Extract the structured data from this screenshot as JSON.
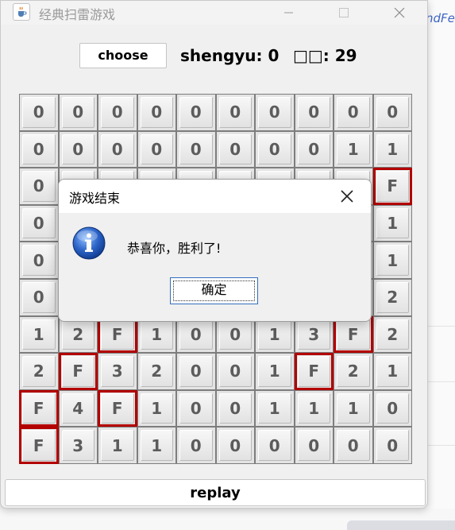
{
  "window": {
    "title": "经典扫雷游戏",
    "icon": "java-cup-icon"
  },
  "toolbar": {
    "choose_label": "choose",
    "shengyu_text": "shengyu: 0",
    "mines_text": "□□: 29"
  },
  "board": {
    "rows": [
      [
        "0",
        "0",
        "0",
        "0",
        "0",
        "0",
        "0",
        "0",
        "0",
        "0"
      ],
      [
        "0",
        "0",
        "0",
        "0",
        "0",
        "0",
        "0",
        "0",
        "1",
        "1"
      ],
      [
        "0",
        "",
        "",
        "",
        "",
        "",
        "",
        "",
        "",
        "F"
      ],
      [
        "0",
        "",
        "",
        "",
        "",
        "",
        "",
        "",
        "",
        "1"
      ],
      [
        "0",
        "",
        "",
        "",
        "",
        "",
        "",
        "",
        "",
        "1"
      ],
      [
        "0",
        "",
        "",
        "",
        "",
        "",
        "",
        "",
        "",
        "2"
      ],
      [
        "1",
        "2",
        "F",
        "1",
        "0",
        "0",
        "1",
        "3",
        "F",
        "2"
      ],
      [
        "2",
        "F",
        "3",
        "2",
        "0",
        "0",
        "1",
        "F",
        "2",
        "1"
      ],
      [
        "F",
        "4",
        "F",
        "1",
        "0",
        "0",
        "1",
        "1",
        "1",
        "0"
      ],
      [
        "F",
        "3",
        "1",
        "1",
        "0",
        "0",
        "0",
        "0",
        "0",
        "0"
      ]
    ],
    "flag_label": "F",
    "flag_border_color": "#b30000"
  },
  "replay_label": "replay",
  "dialog": {
    "title": "游戏结束",
    "message": "恭喜你，胜利了!",
    "ok_label": "确定",
    "icon": "info-icon"
  },
  "background": {
    "code_fragment": "ndFe"
  }
}
